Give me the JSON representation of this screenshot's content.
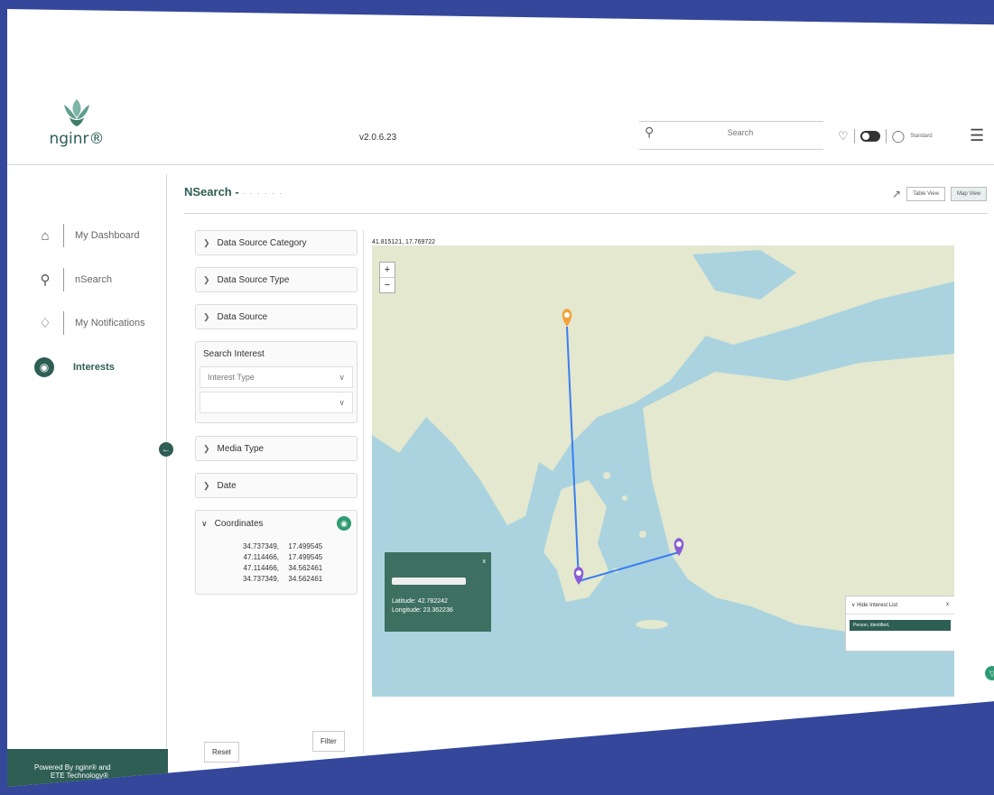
{
  "header": {
    "logo_text": "nginr®",
    "version": "v2.0.6.23",
    "search_placeholder": "Search",
    "user_role": "Standard"
  },
  "sidebar": {
    "items": [
      {
        "label": "My Dashboard",
        "icon": "home-icon"
      },
      {
        "label": "nSearch",
        "icon": "search-icon"
      },
      {
        "label": "My Notifications",
        "icon": "bell-icon"
      },
      {
        "label": "Interests",
        "icon": "interests-icon",
        "active": true
      }
    ],
    "footer_line1": "Powered By nginr® and",
    "footer_line2": "ETE Technology®"
  },
  "page": {
    "title": "NSearch -",
    "table_view": "Table View",
    "map_view": "Map View"
  },
  "filters": {
    "accordions": [
      "Data Source Category",
      "Data Source Type",
      "Data Source"
    ],
    "search_interest": {
      "title": "Search Interest",
      "interest_type": "Interest Type"
    },
    "accordions2": [
      "Media Type",
      "Date"
    ],
    "coordinates": {
      "title": "Coordinates",
      "rows": [
        [
          "34.737349,",
          "17.499545"
        ],
        [
          "47.114466,",
          "17.499545"
        ],
        [
          "47.114466,",
          "34.562461"
        ],
        [
          "34.737349,",
          "34.562461"
        ]
      ]
    },
    "reset_label": "Reset",
    "filter_label": "Filter"
  },
  "map": {
    "cursor_coords": "41.815121, 17.769722",
    "zoom_in": "+",
    "zoom_out": "−",
    "popup": {
      "close": "x",
      "latitude": "Latitude: 42.782242",
      "longitude": "Longitude: 23.362236"
    },
    "interest_list": {
      "title": "Hide Interest List",
      "close": "x",
      "item": "Person, Identified,"
    },
    "colors": {
      "sea": "#aad3df",
      "land": "#e6ead2",
      "pin_orange": "#f2a33a",
      "pin_purple": "#8a5cd6",
      "route": "#3b7ef0"
    }
  }
}
